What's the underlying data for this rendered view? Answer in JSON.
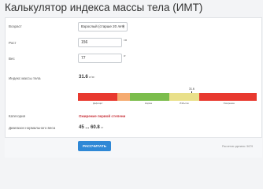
{
  "page": {
    "title": "Калькулятор индекса массы тела (ИМТ)"
  },
  "form": {
    "age": {
      "label": "Возраст",
      "value": "Взрослый (старше 20 лет)"
    },
    "height": {
      "label": "Рост",
      "value": "156",
      "unit": "см"
    },
    "weight": {
      "label": "Вес",
      "value": "77",
      "unit": "кг"
    }
  },
  "result": {
    "bmi_label": "Индекс массы тела",
    "bmi_value": "31.6",
    "bmi_unit": "кг/м²",
    "marker_label": "31.6",
    "scale_segments": [
      {
        "name": "Дефицит",
        "color": "#e8392f",
        "fraction": 0.22
      },
      {
        "name": "",
        "color": "#f5ab70",
        "fraction": 0.07
      },
      {
        "name": "Норма",
        "color": "#7cbd4d",
        "fraction": 0.22
      },
      {
        "name": "Избыток",
        "color": "#e9e08a",
        "fraction": 0.17
      },
      {
        "name": "Ожирение",
        "color": "#e8392f",
        "fraction": 0.32
      }
    ],
    "category_label": "Категория",
    "category_value": "Ожирение первой степени",
    "range_label": "Диапазон нормального веса",
    "range_from": "45",
    "range_sep": "...",
    "range_to": "60.8",
    "range_unit": "кг"
  },
  "footer": {
    "button_label": "РАССЧИТАТЬ",
    "counter": "Расчетов сделано: 5679"
  },
  "colors": {
    "accent": "#2f88d6",
    "danger": "#c8323a"
  }
}
